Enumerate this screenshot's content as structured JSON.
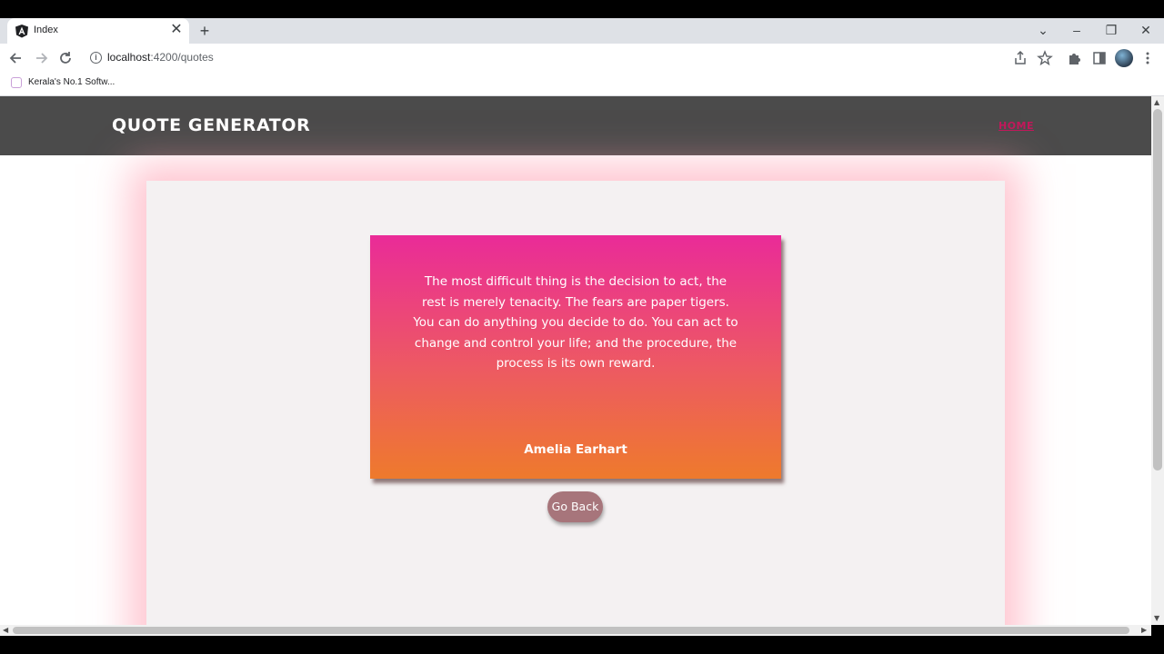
{
  "browser": {
    "tab_title": "Index",
    "tab_close": "✕",
    "new_tab": "+",
    "url_host": "localhost",
    "url_path": ":4200/quotes",
    "bookmark_label": "Kerala's No.1 Softw...",
    "window_controls": {
      "minimize": "–",
      "restore": "❐",
      "close": "✕",
      "tab_search": "⌄"
    },
    "icons": {
      "back": "arrow-left-icon",
      "forward": "arrow-right-icon",
      "reload": "reload-icon",
      "share": "share-icon",
      "bookmark_star": "star-icon",
      "extensions": "puzzle-icon",
      "side_panel": "side-panel-icon",
      "menu": "kebab-menu-icon"
    }
  },
  "site": {
    "brand": "QUOTE GENERATOR",
    "nav_home": "HOME",
    "colors": {
      "header_bg": "#4b4b4b",
      "home_link": "#c2185b",
      "card_gradient_top": "#ea2b98",
      "card_gradient_bottom": "#ee7a2c",
      "button_bg": "#a7757b"
    }
  },
  "quote": {
    "text": "The most difficult thing is the decision to act, the rest is merely tenacity. The fears are paper tigers. You can do anything you decide to do. You can act to change and control your life; and the procedure, the process is its own reward.",
    "author": "Amelia Earhart"
  },
  "actions": {
    "go_back_label": "Go Back"
  }
}
